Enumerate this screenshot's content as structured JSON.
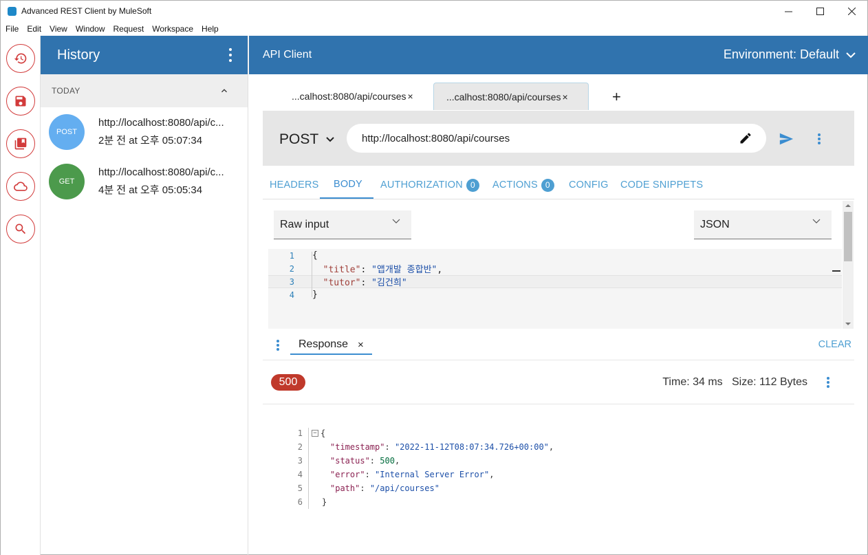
{
  "window": {
    "title": "Advanced REST Client by MuleSoft"
  },
  "menu": [
    "File",
    "Edit",
    "View",
    "Window",
    "Request",
    "Workspace",
    "Help"
  ],
  "rail": {
    "items": [
      "history-icon",
      "save-icon",
      "library-icon",
      "cloud-icon",
      "search-icon"
    ],
    "accent": "#d23b3b"
  },
  "history": {
    "title": "History",
    "group": "TODAY",
    "items": [
      {
        "method": "POST",
        "url": "http://localhost:8080/api/c...",
        "time": "2분 전 at 오후 05:07:34",
        "color": "#64aef0"
      },
      {
        "method": "GET",
        "url": "http://localhost:8080/api/c...",
        "time": "4분 전 at 오후 05:05:34",
        "color": "#4c9a4c"
      }
    ]
  },
  "header": {
    "title": "API Client",
    "environment": "Environment: Default",
    "color": "#3073ae"
  },
  "tabs": [
    {
      "label": "...calhost:8080/api/courses",
      "close": "×"
    },
    {
      "label": "...calhost:8080/api/courses",
      "close": "×"
    }
  ],
  "add_tab": "+",
  "request": {
    "method": "POST",
    "url": "http://localhost:8080/api/courses"
  },
  "sub_tabs": {
    "headers": "HEADERS",
    "body": "BODY",
    "authorization": "AUTHORIZATION",
    "authorization_count": "0",
    "actions": "ACTIONS",
    "actions_count": "0",
    "config": "CONFIG",
    "snippets": "CODE SNIPPETS"
  },
  "body_editor": {
    "mode": "Raw input",
    "content_type": "JSON",
    "lines": [
      {
        "n": "1",
        "open": "{"
      },
      {
        "n": "2",
        "key": "\"title\"",
        "sep": ": ",
        "value": "\"앱개발 종합반\"",
        "end": ","
      },
      {
        "n": "3",
        "key": "\"tutor\"",
        "sep": ": ",
        "value": "\"김건희\"",
        "end": ""
      },
      {
        "n": "4",
        "open": "}"
      }
    ]
  },
  "response": {
    "tab_label": "Response",
    "close": "×",
    "clear": "CLEAR",
    "status": "500",
    "status_color": "#c0392b",
    "meta": "Time: 34 ms   Size: 112 Bytes",
    "lines": [
      {
        "n": "1",
        "text": "{"
      },
      {
        "n": "2",
        "key": "\"timestamp\"",
        "value": "\"2022-11-12T08:07:34.726+00:00\"",
        "end": ","
      },
      {
        "n": "3",
        "key": "\"status\"",
        "num": "500",
        "end": ","
      },
      {
        "n": "4",
        "key": "\"error\"",
        "value": "\"Internal Server Error\"",
        "end": ","
      },
      {
        "n": "5",
        "key": "\"path\"",
        "value": "\"/api/courses\"",
        "end": ""
      },
      {
        "n": "6",
        "text": "}"
      }
    ]
  }
}
